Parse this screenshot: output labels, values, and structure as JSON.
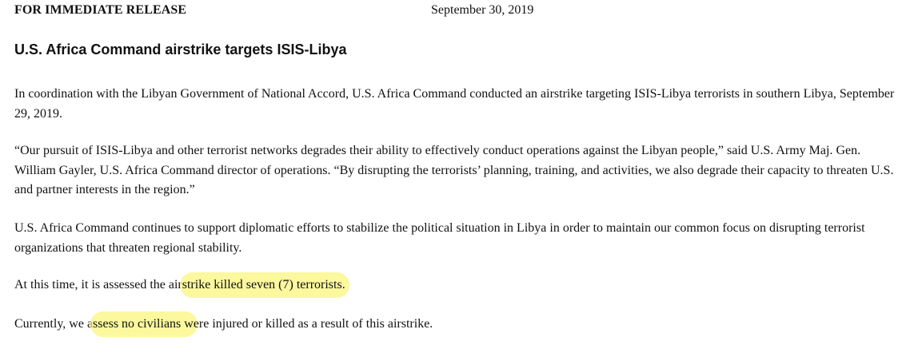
{
  "header": {
    "release_label": "FOR IMMEDIATE RELEASE",
    "date": "September 30, 2019"
  },
  "headline": "U.S. Africa Command airstrike targets ISIS-Libya",
  "paragraphs": {
    "p1": "In coordination with the Libyan Government of National Accord, U.S. Africa Command conducted an airstrike targeting ISIS-Libya terrorists in southern Libya, September 29, 2019.",
    "p2": "“Our pursuit of ISIS-Libya and other terrorist networks degrades their ability to effectively conduct operations against the Libyan people,” said U.S. Army Maj. Gen. William Gayler, U.S. Africa Command director of operations. “By disrupting the terrorists’ planning, training, and activities, we also degrade their capacity to threaten U.S. and partner interests in the region.”",
    "p3": "U.S. Africa Command continues to support diplomatic efforts to stabilize the political situation in Libya in order to maintain our common focus on disrupting terrorist organizations that threaten regional stability.",
    "p4": {
      "before": "At this time, it is assessed the air",
      "highlighted": "strike killed seven (7) terrorists.",
      "after": ""
    },
    "p5": {
      "before": "Currently, we a",
      "highlighted": "ssess no civilians w",
      "after": "ere injured or killed as a result of this airstrike."
    }
  },
  "highlight_color": "#faf578"
}
